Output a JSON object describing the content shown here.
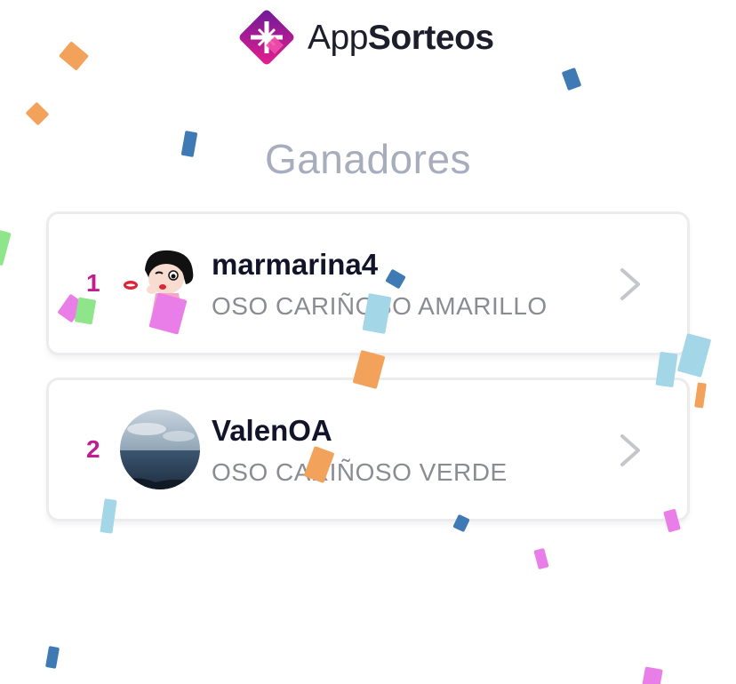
{
  "header": {
    "brand_prefix": "App",
    "brand_suffix": "Sorteos",
    "brand_colors": [
      "#7b1fa2",
      "#e91e8c"
    ]
  },
  "page": {
    "title": "Ganadores"
  },
  "winners": [
    {
      "rank": "1",
      "username": "marmarina4",
      "prize": "OSO CARIÑOSO AMARILLO",
      "avatar": "cartoon-avatar"
    },
    {
      "rank": "2",
      "username": "ValenOA",
      "prize": "OSO CARIÑOSO VERDE",
      "avatar": "sea-photo-avatar"
    }
  ],
  "icons": {
    "chevron": "chevron-right-icon",
    "logo": "appsorteos-logo-icon"
  },
  "colors": {
    "rank": "#c21d8e",
    "title": "#a8adbd",
    "confetti": [
      "#f2a25a",
      "#3f7ab4",
      "#a3d6e6",
      "#ea7ee8",
      "#8ee58a"
    ]
  }
}
